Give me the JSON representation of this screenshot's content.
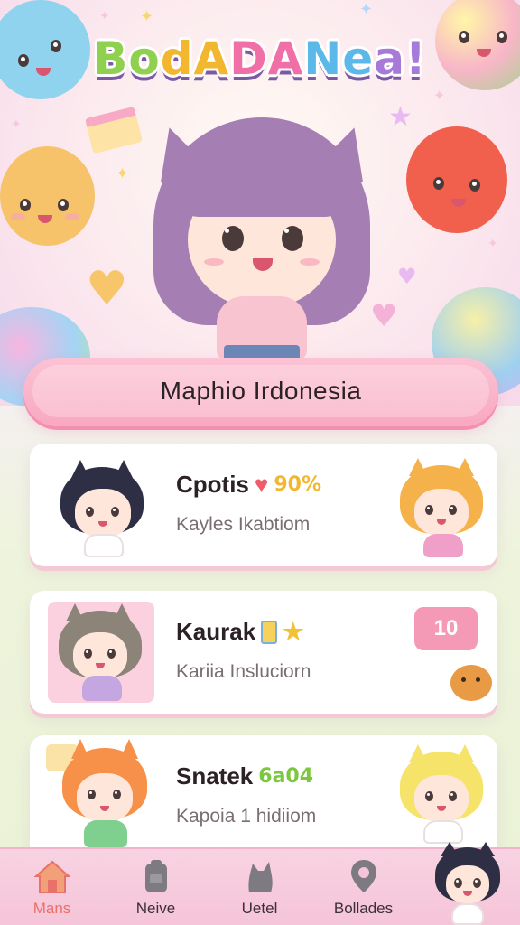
{
  "app": {
    "title_parts": [
      "Bo",
      "dA",
      "DA",
      "Ne",
      "a!"
    ]
  },
  "region": {
    "label": "Maphio  Irdonesia"
  },
  "cards": [
    {
      "title": "Cpotis",
      "stat": "90%",
      "subtitle": "Kayles Ikabtiom",
      "title_color": "#2c2226",
      "stat_color": "#f2b62f"
    },
    {
      "title": "Kaurak",
      "subtitle": "Kariia Insluciorn",
      "badge": "10",
      "title_color": "#2c2226"
    },
    {
      "title": "Snatek",
      "stat": "6a04",
      "subtitle": "Kapoia 1 hidiiom",
      "title_color": "#2c2226",
      "stat_color": "#7cc640"
    }
  ],
  "nav": {
    "items": [
      {
        "label": "Mans",
        "icon": "home-icon",
        "active": true
      },
      {
        "label": "Neive",
        "icon": "backpack-icon",
        "active": false
      },
      {
        "label": "Uetel",
        "icon": "cat-icon",
        "active": false
      },
      {
        "label": "Bollades",
        "icon": "location-pin-icon",
        "active": false
      }
    ]
  },
  "colors": {
    "accent_pink": "#f49ab7",
    "active_nav": "#e8716a",
    "card_bg": "#ffffff"
  }
}
